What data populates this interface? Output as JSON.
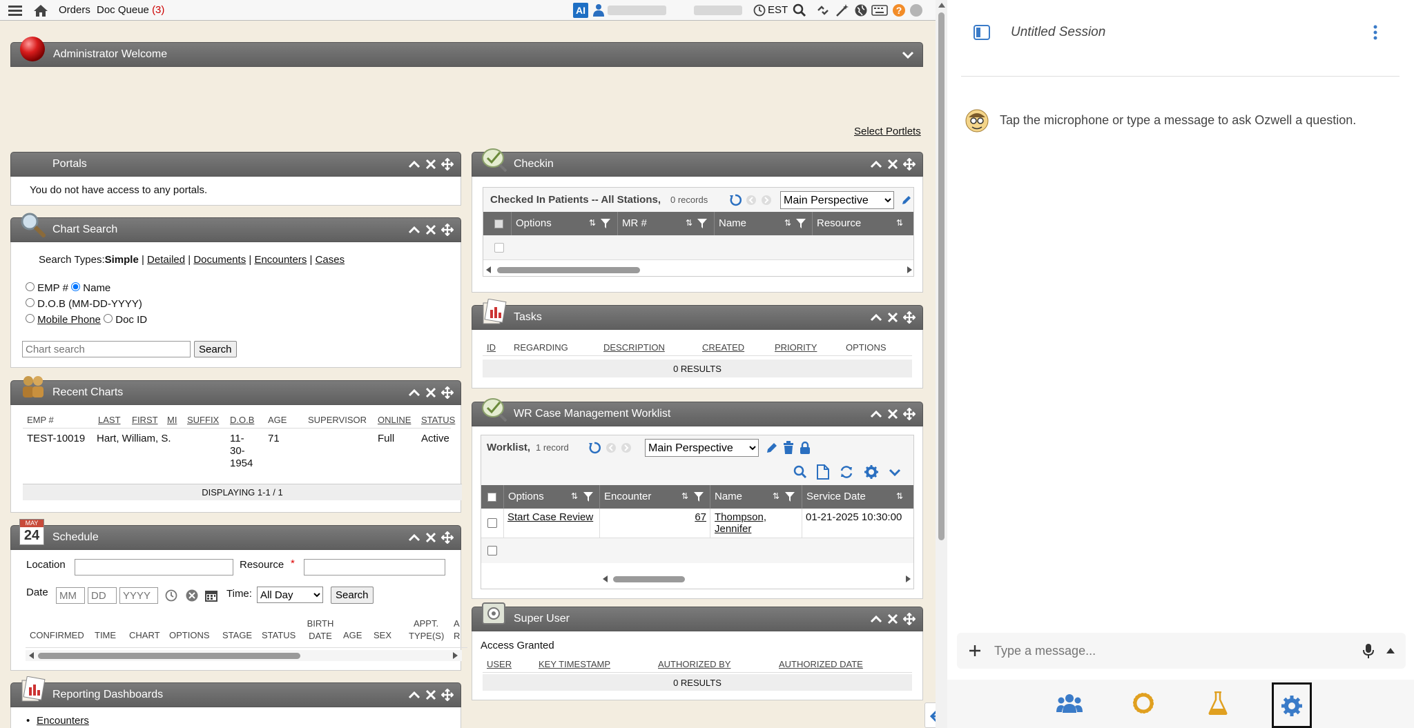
{
  "topbar": {
    "orders": "Orders",
    "doc_queue": "Doc Queue",
    "doc_queue_count": "(3)",
    "ai_badge": "AI",
    "timezone": "EST"
  },
  "welcome": {
    "title": "Administrator Welcome"
  },
  "select_portlets": "Select Portlets",
  "portals": {
    "title": "Portals",
    "message": "You do not have access to any portals."
  },
  "chart_search": {
    "title": "Chart Search",
    "search_types_label": "Search Types:",
    "types": [
      "Simple",
      "Detailed",
      "Documents",
      "Encounters",
      "Cases"
    ],
    "radio_emp": "EMP #",
    "radio_name": "Name",
    "radio_dob": "D.O.B (MM-DD-YYYY)",
    "radio_mobile": "Mobile Phone",
    "radio_docid": "Doc ID",
    "placeholder": "Chart search",
    "button": "Search"
  },
  "recent_charts": {
    "title": "Recent Charts",
    "columns": [
      "EMP #",
      "LAST",
      "FIRST",
      "MI",
      "SUFFIX",
      "D.O.B",
      "AGE",
      "SUPERVISOR",
      "ONLINE",
      "STATUS"
    ],
    "row": {
      "emp": "TEST-10019",
      "name": "Hart, William, S.",
      "dob1": "11-",
      "dob2": "30-",
      "dob3": "1954",
      "age": "71",
      "online": "Full",
      "status": "Active"
    },
    "footer": "DISPLAYING 1-1 / 1"
  },
  "schedule": {
    "title": "Schedule",
    "icon_month": "MAY",
    "icon_day": "24",
    "location_label": "Location",
    "resource_label": "Resource",
    "required_mark": "*",
    "date_label": "Date",
    "mm": "MM",
    "dd": "DD",
    "yyyy": "YYYY",
    "time_label": "Time:",
    "time_value": "All Day",
    "search_button": "Search",
    "columns": [
      "CONFIRMED",
      "TIME",
      "CHART",
      "OPTIONS",
      "STAGE",
      "STATUS",
      "BIRTH DATE",
      "AGE",
      "SEX",
      "APPT. TYPE(S)",
      "A R"
    ]
  },
  "reporting": {
    "title": "Reporting Dashboards",
    "item": "Encounters"
  },
  "checkin": {
    "title": "Checkin",
    "grid_title": "Checked In Patients -- All Stations,",
    "grid_count": "0 records",
    "perspective": "Main Perspective",
    "columns": [
      "Options",
      "MR #",
      "Name",
      "Resource"
    ]
  },
  "tasks": {
    "title": "Tasks",
    "columns": [
      "ID",
      "REGARDING",
      "DESCRIPTION",
      "CREATED",
      "PRIORITY",
      "OPTIONS"
    ],
    "results": "0 RESULTS"
  },
  "worklist": {
    "title": "WR Case Management Worklist",
    "grid_title": "Worklist,",
    "grid_count": "1 record",
    "perspective": "Main Perspective",
    "columns": [
      "Options",
      "Encounter",
      "Name",
      "Service Date"
    ],
    "row": {
      "option": "Start Case Review",
      "encounter": "67",
      "name1": "Thompson,",
      "name2": "Jennifer",
      "service_date": "01-21-2025 10:30:00"
    }
  },
  "super_user": {
    "title": "Super User",
    "status": "Access Granted",
    "columns": [
      "USER",
      "KEY TIMESTAMP",
      "AUTHORIZED BY",
      "AUTHORIZED DATE"
    ],
    "results": "0 RESULTS"
  },
  "chat": {
    "session_title": "Untitled Session",
    "hint": "Tap the microphone or type a message to ask Ozwell a question.",
    "input_placeholder": "Type a message..."
  },
  "colors": {
    "accent_blue": "#4a90c8",
    "panel_gray": "#6b6b6b",
    "background": "#f3ede0",
    "link_orange": "#e0a020"
  }
}
